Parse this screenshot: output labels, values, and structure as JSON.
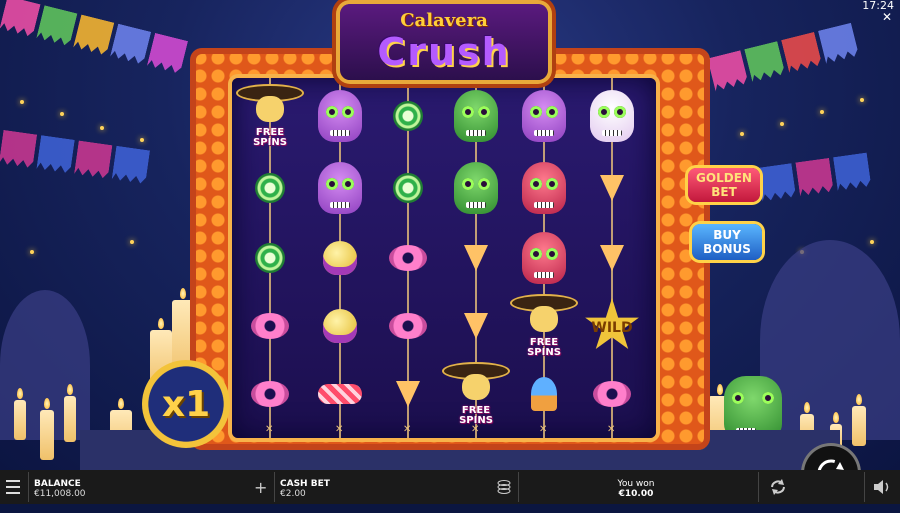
{
  "clock": "17:24",
  "close_label": "✕",
  "logo": {
    "line1": "Calavera",
    "line2": "Crush"
  },
  "side_buttons": {
    "golden_bet": [
      "GOLDEN",
      "BET"
    ],
    "buy_bonus": [
      "BUY",
      "BONUS"
    ]
  },
  "multiplier": "x1",
  "reels": {
    "columns": [
      [
        "mariachi-free-spins",
        "lollipop",
        "lollipop",
        "donut",
        "donut"
      ],
      [
        "purple-skull",
        "purple-skull",
        "cupcake-yellow",
        "cupcake-yellow",
        "wrapped-candy"
      ],
      [
        "lollipop",
        "lollipop",
        "donut",
        "donut",
        "pizza-slice"
      ],
      [
        "green-skull",
        "green-skull",
        "pizza-slice",
        "pizza-slice",
        "mariachi-free-spins"
      ],
      [
        "purple-skull",
        "red-skull",
        "red-skull",
        "mariachi-free-spins",
        "cupcake-blue"
      ],
      [
        "white-skull",
        "pizza-slice",
        "pizza-slice",
        "wild-star",
        "donut"
      ]
    ],
    "free_spins_label": [
      "FREE",
      "SPINS"
    ],
    "wild_label": "WILD"
  },
  "bottom_bar": {
    "balance_label": "BALANCE",
    "balance_value": "€11,008.00",
    "cash_bet_label": "CASH BET",
    "cash_bet_value": "€2.00",
    "you_won_label": "You won",
    "you_won_value": "€10.00"
  },
  "colors": {
    "frame": "#e0581a",
    "reel_bg": "#2a1a70",
    "gold": "#ffd248"
  }
}
